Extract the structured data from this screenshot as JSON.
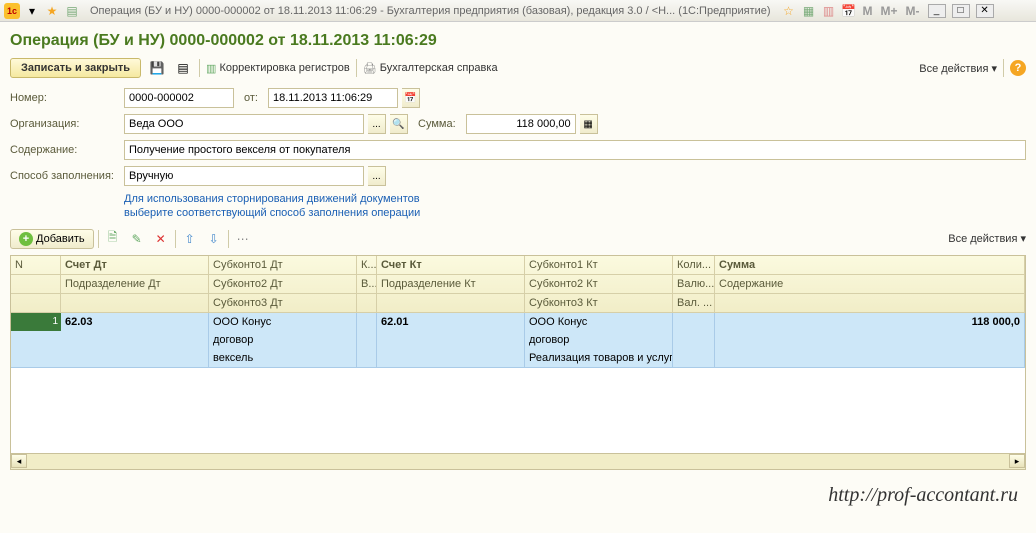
{
  "window_title": "Операция (БУ и НУ) 0000-000002 от 18.11.2013 11:06:29 - Бухгалтерия предприятия (базовая), редакция 3.0 / <Н...   (1С:Предприятие)",
  "page_title": "Операция (БУ и НУ) 0000-000002 от 18.11.2013 11:06:29",
  "toolbar": {
    "save_close": "Записать и закрыть",
    "reg_correction": "Корректировка регистров",
    "accounting_ref": "Бухгалтерская справка",
    "all_actions": "Все действия"
  },
  "form": {
    "number_label": "Номер:",
    "number": "0000-000002",
    "from_label": "от:",
    "date": "18.11.2013 11:06:29",
    "org_label": "Организация:",
    "org": "Веда ООО",
    "sum_label": "Сумма:",
    "sum": "118 000,00",
    "desc_label": "Содержание:",
    "desc": "Получение простого векселя от покупателя",
    "fill_label": "Способ заполнения:",
    "fill": "Вручную",
    "hint1": "Для использования сторнирования движений документов",
    "hint2": "выберите соответствующий способ заполнения операции"
  },
  "grid_toolbar": {
    "add": "Добавить",
    "all_actions": "Все действия"
  },
  "grid_head": {
    "n": "N",
    "acc_dt": "Счет Дт",
    "sub_dt": "Подразделение Дт",
    "s1dt": "Субконто1 Дт",
    "s2dt": "Субконто2 Дт",
    "s3dt": "Субконто3 Дт",
    "k": "К...",
    "v": "В...",
    "acc_kt": "Счет Кт",
    "sub_kt": "Подразделение Кт",
    "s1kt": "Субконто1 Кт",
    "s2kt": "Субконто2 Кт",
    "s3kt": "Субконто3 Кт",
    "qty": "Коли...",
    "cur": "Валю...",
    "cur2": "Вал. ...",
    "sum": "Сумма",
    "cont": "Содержание"
  },
  "row": {
    "n": "1",
    "acc_dt": "62.03",
    "s1dt": "ООО Конус",
    "s2dt": "договор",
    "s3dt": "вексель",
    "acc_kt": "62.01",
    "s1kt": "ООО Конус",
    "s2kt": "договор",
    "s3kt": "Реализация товаров и услуг ...",
    "sum": "118 000,0"
  },
  "watermark": "http://prof-accontant.ru"
}
